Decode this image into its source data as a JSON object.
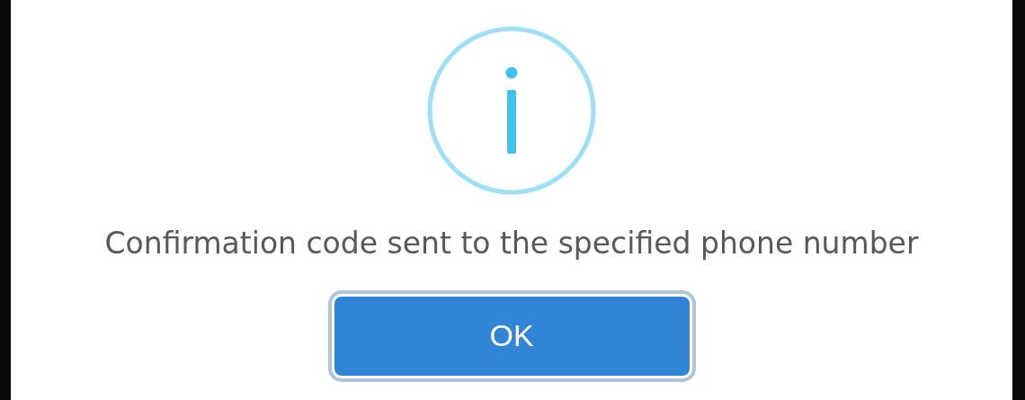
{
  "dialog": {
    "message": "Confirmation code sent to the specified phone number",
    "confirm_button": {
      "label": "OK",
      "focused": true
    }
  }
}
